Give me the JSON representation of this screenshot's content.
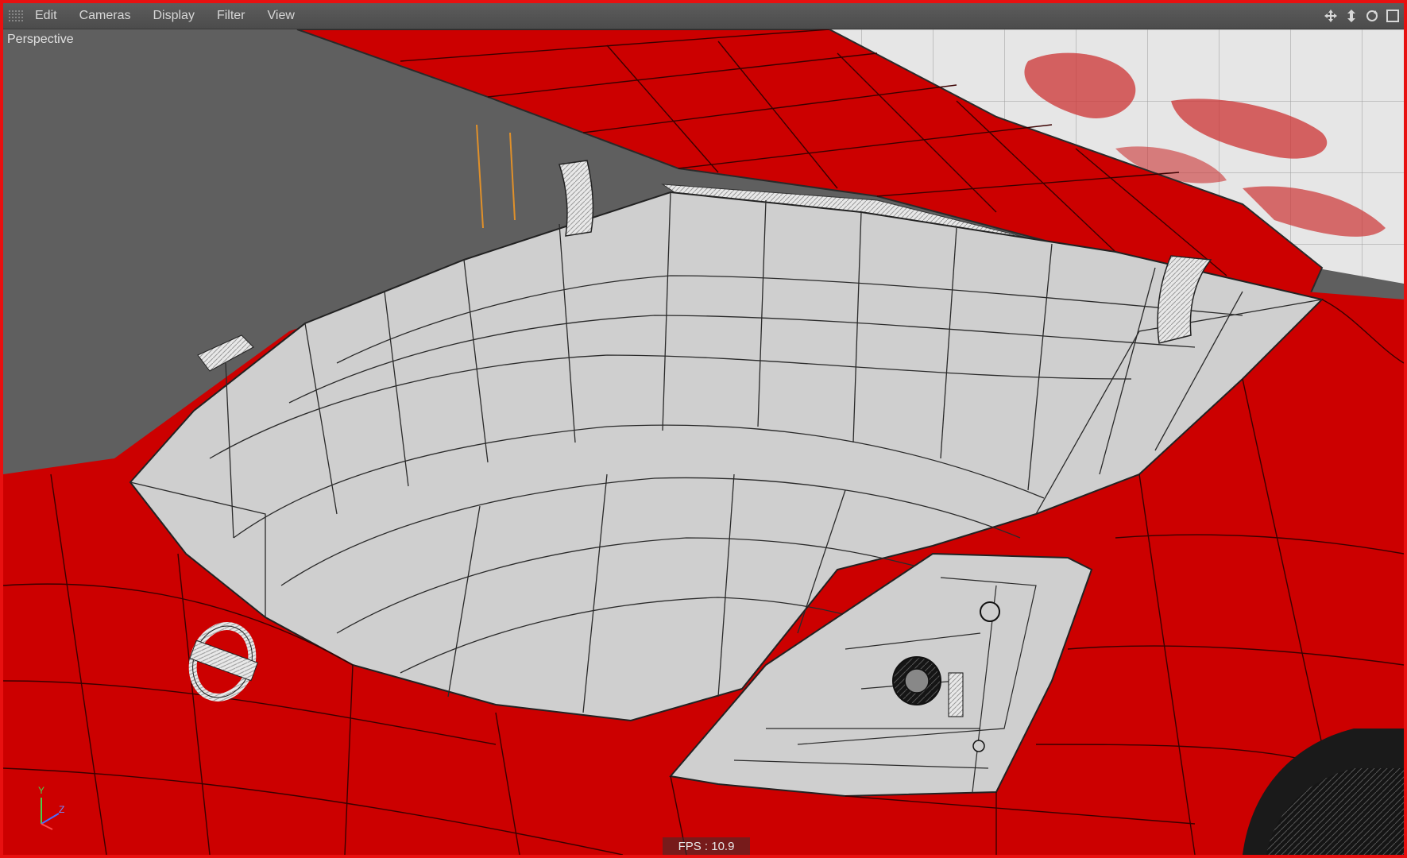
{
  "menubar": {
    "items": [
      "Edit",
      "Cameras",
      "Display",
      "Filter",
      "View"
    ],
    "nav_icons": [
      "move-icon",
      "dolly-icon",
      "rotate-icon",
      "maximize-icon"
    ]
  },
  "viewport": {
    "camera_label": "Perspective",
    "fps_text": "FPS : 10.9",
    "axis_labels": {
      "y": "Y",
      "z": "Z"
    }
  },
  "colors": {
    "car_body": "#cc0000",
    "interior": "#cfcfcf",
    "background": "#5f5f5f",
    "wire": "#2a2a2a",
    "menubar": "#555555"
  }
}
